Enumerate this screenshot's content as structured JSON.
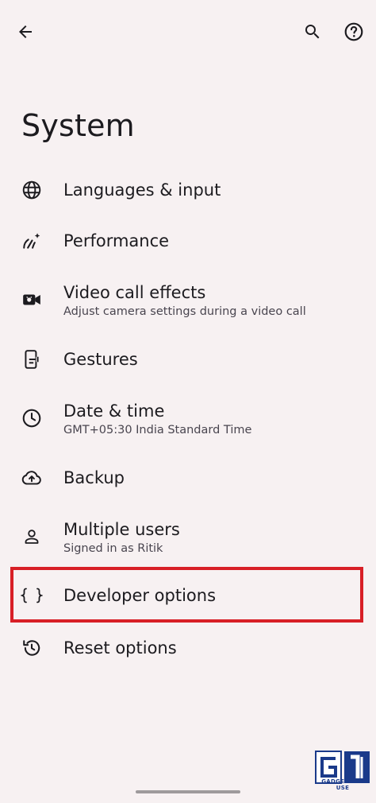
{
  "page": {
    "title": "System"
  },
  "toolbar": {
    "back_icon": "arrow-back-icon",
    "search_icon": "search-icon",
    "help_icon": "help-icon"
  },
  "items": [
    {
      "label": "Languages & input",
      "sub": "",
      "icon": "globe-icon"
    },
    {
      "label": "Performance",
      "sub": "",
      "icon": "performance-icon"
    },
    {
      "label": "Video call effects",
      "sub": "Adjust camera settings during a video call",
      "icon": "video-camera-icon"
    },
    {
      "label": "Gestures",
      "sub": "",
      "icon": "gestures-phone-icon"
    },
    {
      "label": "Date & time",
      "sub": "GMT+05:30 India Standard Time",
      "icon": "clock-icon"
    },
    {
      "label": "Backup",
      "sub": "",
      "icon": "cloud-upload-icon"
    },
    {
      "label": "Multiple users",
      "sub": "Signed in as Ritik",
      "icon": "person-icon"
    },
    {
      "label": "Developer options",
      "sub": "",
      "icon": "braces-icon"
    },
    {
      "label": "Reset options",
      "sub": "",
      "icon": "history-icon"
    }
  ],
  "watermark": {
    "text": "GADGETS TO USE"
  },
  "colors": {
    "background": "#f7f1f2",
    "text_primary": "#1c1b1f",
    "text_secondary": "#49454f",
    "highlight": "#d81f26"
  }
}
